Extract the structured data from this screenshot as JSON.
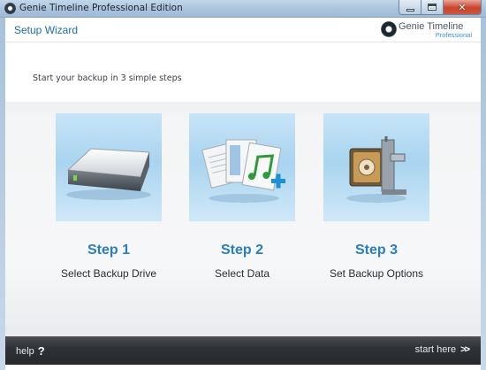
{
  "window": {
    "title": "Genie Timeline Professional Edition",
    "controls": [
      "minimize",
      "maximize",
      "close"
    ]
  },
  "header": {
    "title": "Setup Wizard",
    "logo_name": "Genie Timeline",
    "logo_edition": "Professional"
  },
  "intro": "Start your backup in 3 simple steps",
  "steps": [
    {
      "number": "Step 1",
      "label": "Select Backup Drive",
      "icon": "hard-drive-icon"
    },
    {
      "number": "Step 2",
      "label": "Select Data",
      "icon": "documents-icon"
    },
    {
      "number": "Step 3",
      "label": "Set Backup Options",
      "icon": "safe-vise-icon"
    }
  ],
  "footer": {
    "help_label": "help",
    "help_glyph": "?",
    "start_label": "start here",
    "start_glyph": ">>"
  },
  "colors": {
    "accent": "#2a7ebf",
    "wizard_title": "#1d6ea8",
    "footer_bg": "#2f3236",
    "card_bg": "#b5daf2"
  }
}
